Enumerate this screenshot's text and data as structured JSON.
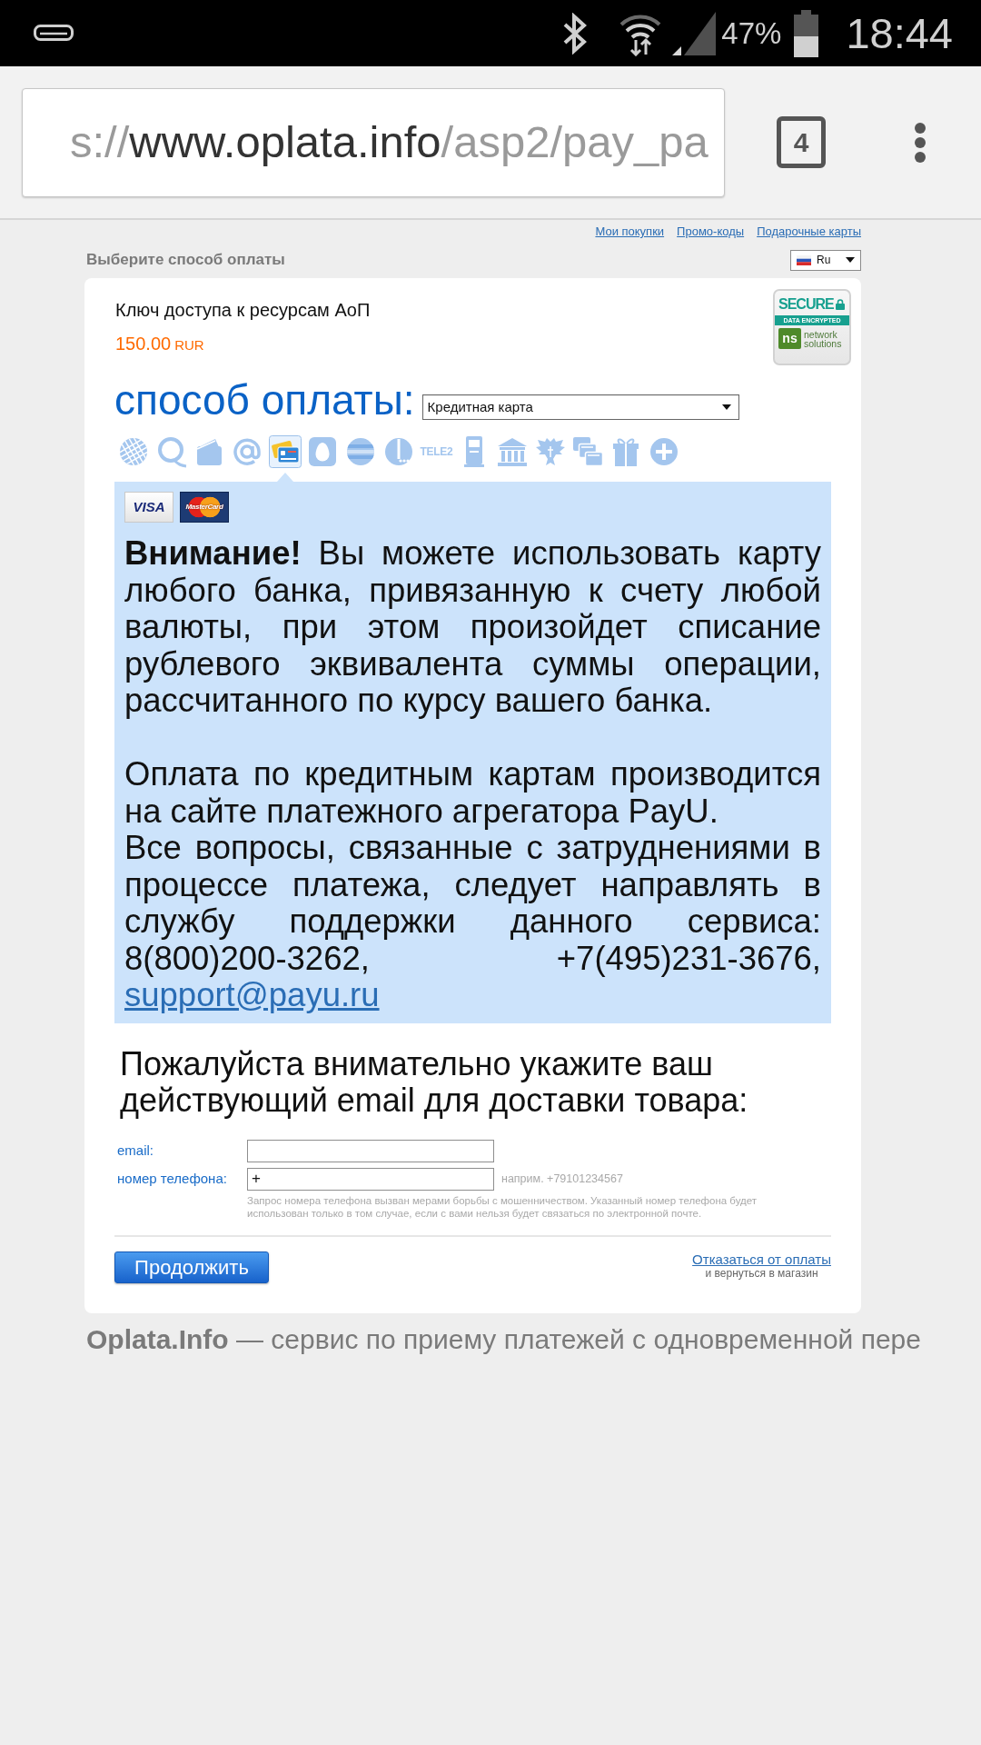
{
  "status_bar": {
    "battery": "47%",
    "time": "18:44"
  },
  "browser": {
    "url": {
      "scheme": "s://",
      "host": "www.oplata.info",
      "path": "/asp2/pay_pa"
    },
    "tab_count": "4"
  },
  "top_links": [
    "Мои покупки",
    "Промо-коды",
    "Подарочные карты"
  ],
  "page_title": "Выберите способ оплаты",
  "language": {
    "label": "Ru"
  },
  "product": {
    "name": "Ключ доступа к ресурсам АоП",
    "price": "150.00",
    "currency": "RUR"
  },
  "secure_badge": {
    "title": "SECURE",
    "band": "DATA ENCRYPTED",
    "logo": "ns",
    "brand": "network solutions"
  },
  "payment": {
    "label": "способ оплаты:",
    "select_value": "Кредитная карта",
    "methods": [
      {
        "kind": "grid-ball",
        "selected": false
      },
      {
        "kind": "ring",
        "selected": false
      },
      {
        "kind": "wallet",
        "selected": false
      },
      {
        "kind": "at-sign",
        "selected": false
      },
      {
        "kind": "cards",
        "selected": true
      },
      {
        "kind": "egg",
        "selected": false
      },
      {
        "kind": "striped-ball",
        "selected": false
      },
      {
        "kind": "dotted-circle",
        "selected": false
      },
      {
        "kind": "wordmark",
        "label": "TELE2",
        "selected": false
      },
      {
        "kind": "terminal",
        "selected": false
      },
      {
        "kind": "bank",
        "selected": false
      },
      {
        "kind": "eagle",
        "selected": false
      },
      {
        "kind": "windows",
        "selected": false
      },
      {
        "kind": "gift",
        "selected": false
      },
      {
        "kind": "plus",
        "selected": false
      }
    ]
  },
  "notice": {
    "card_logos": [
      {
        "kind": "visa",
        "label": "VISA"
      },
      {
        "kind": "mastercard",
        "label": "MasterCard"
      }
    ],
    "paragraphs": [
      {
        "sentences": [
          {
            "text": "**Внимание!** Вы можете использовать карту любого банка, привязанную к счету любой валюты, при этом произойдет списание рублевого эквивалента суммы операции, рассчитанного по курсу вашего банка."
          }
        ]
      },
      {
        "sentences": [
          {
            "text": "Оплата по кредитным картам производится на сайте платежного агрегатора PayU."
          },
          {
            "text": "Все вопросы, связанные с затруднениями в процессе платежа, следует направлять в службу поддержки данного сервиса: 8(800)200-3262, +7(495)231-3676,",
            "link": "support@payu.ru"
          }
        ]
      }
    ]
  },
  "email_prompt": "Пожалуйста внимательно укажите ваш действующий email для доставки товара:",
  "form": {
    "fields": [
      {
        "label": "email:"
      },
      {
        "label": "номер телефона:",
        "value": "+",
        "hint": "наприм. +79101234567"
      }
    ],
    "note": "Запрос номера телефона вызван мерами борьбы с мошенничеством. Указанный номер телефона будет использован только в том случае, если с вами нельзя будет связаться по электронной почте."
  },
  "actions": {
    "submit": "Продолжить",
    "cancel_link": "Отказаться от оплаты",
    "cancel_note": "и вернуться в магазин"
  },
  "footer": "**Oplata.Info** — сервис по приему платежей с одновременной пере"
}
